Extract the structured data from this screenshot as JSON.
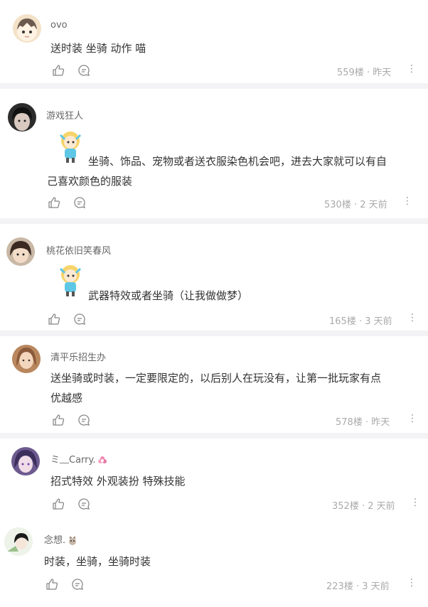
{
  "comments": [
    {
      "username": "ovo",
      "lines": [
        "送时装 坐骑 动作 喵"
      ],
      "floor": "559楼",
      "time": "昨天"
    },
    {
      "username": "游戏狂人",
      "lines": [
        "坐骑、饰品、宠物或者送衣服染色机会吧，进去大家就可以有自",
        "己喜欢颜色的服装"
      ],
      "floor": "530楼",
      "time": "2 天前"
    },
    {
      "username": "桃花依旧笑春风",
      "lines": [
        "武器特效或者坐骑（让我做做梦）"
      ],
      "floor": "165楼",
      "time": "3 天前"
    },
    {
      "username": "清平乐招生办",
      "lines": [
        "送坐骑或时装，一定要限定的，以后别人在玩没有，让第一批玩家有点",
        "优越感"
      ],
      "floor": "578楼",
      "time": "昨天"
    },
    {
      "username": "ミ﹏Carry.",
      "lines": [
        "招式特效 外观装扮 特殊技能"
      ],
      "floor": "352楼",
      "time": "2 天前"
    },
    {
      "username": "念想.",
      "lines": [
        "时装，坐骑，坐骑时装"
      ],
      "floor": "223楼",
      "time": "3 天前"
    }
  ],
  "separator": " · ",
  "more_glyph": "⋮",
  "colors": {
    "meta": "#aaaaaa",
    "text": "#333333",
    "name": "#666666",
    "divider": "#f3f3f5"
  }
}
